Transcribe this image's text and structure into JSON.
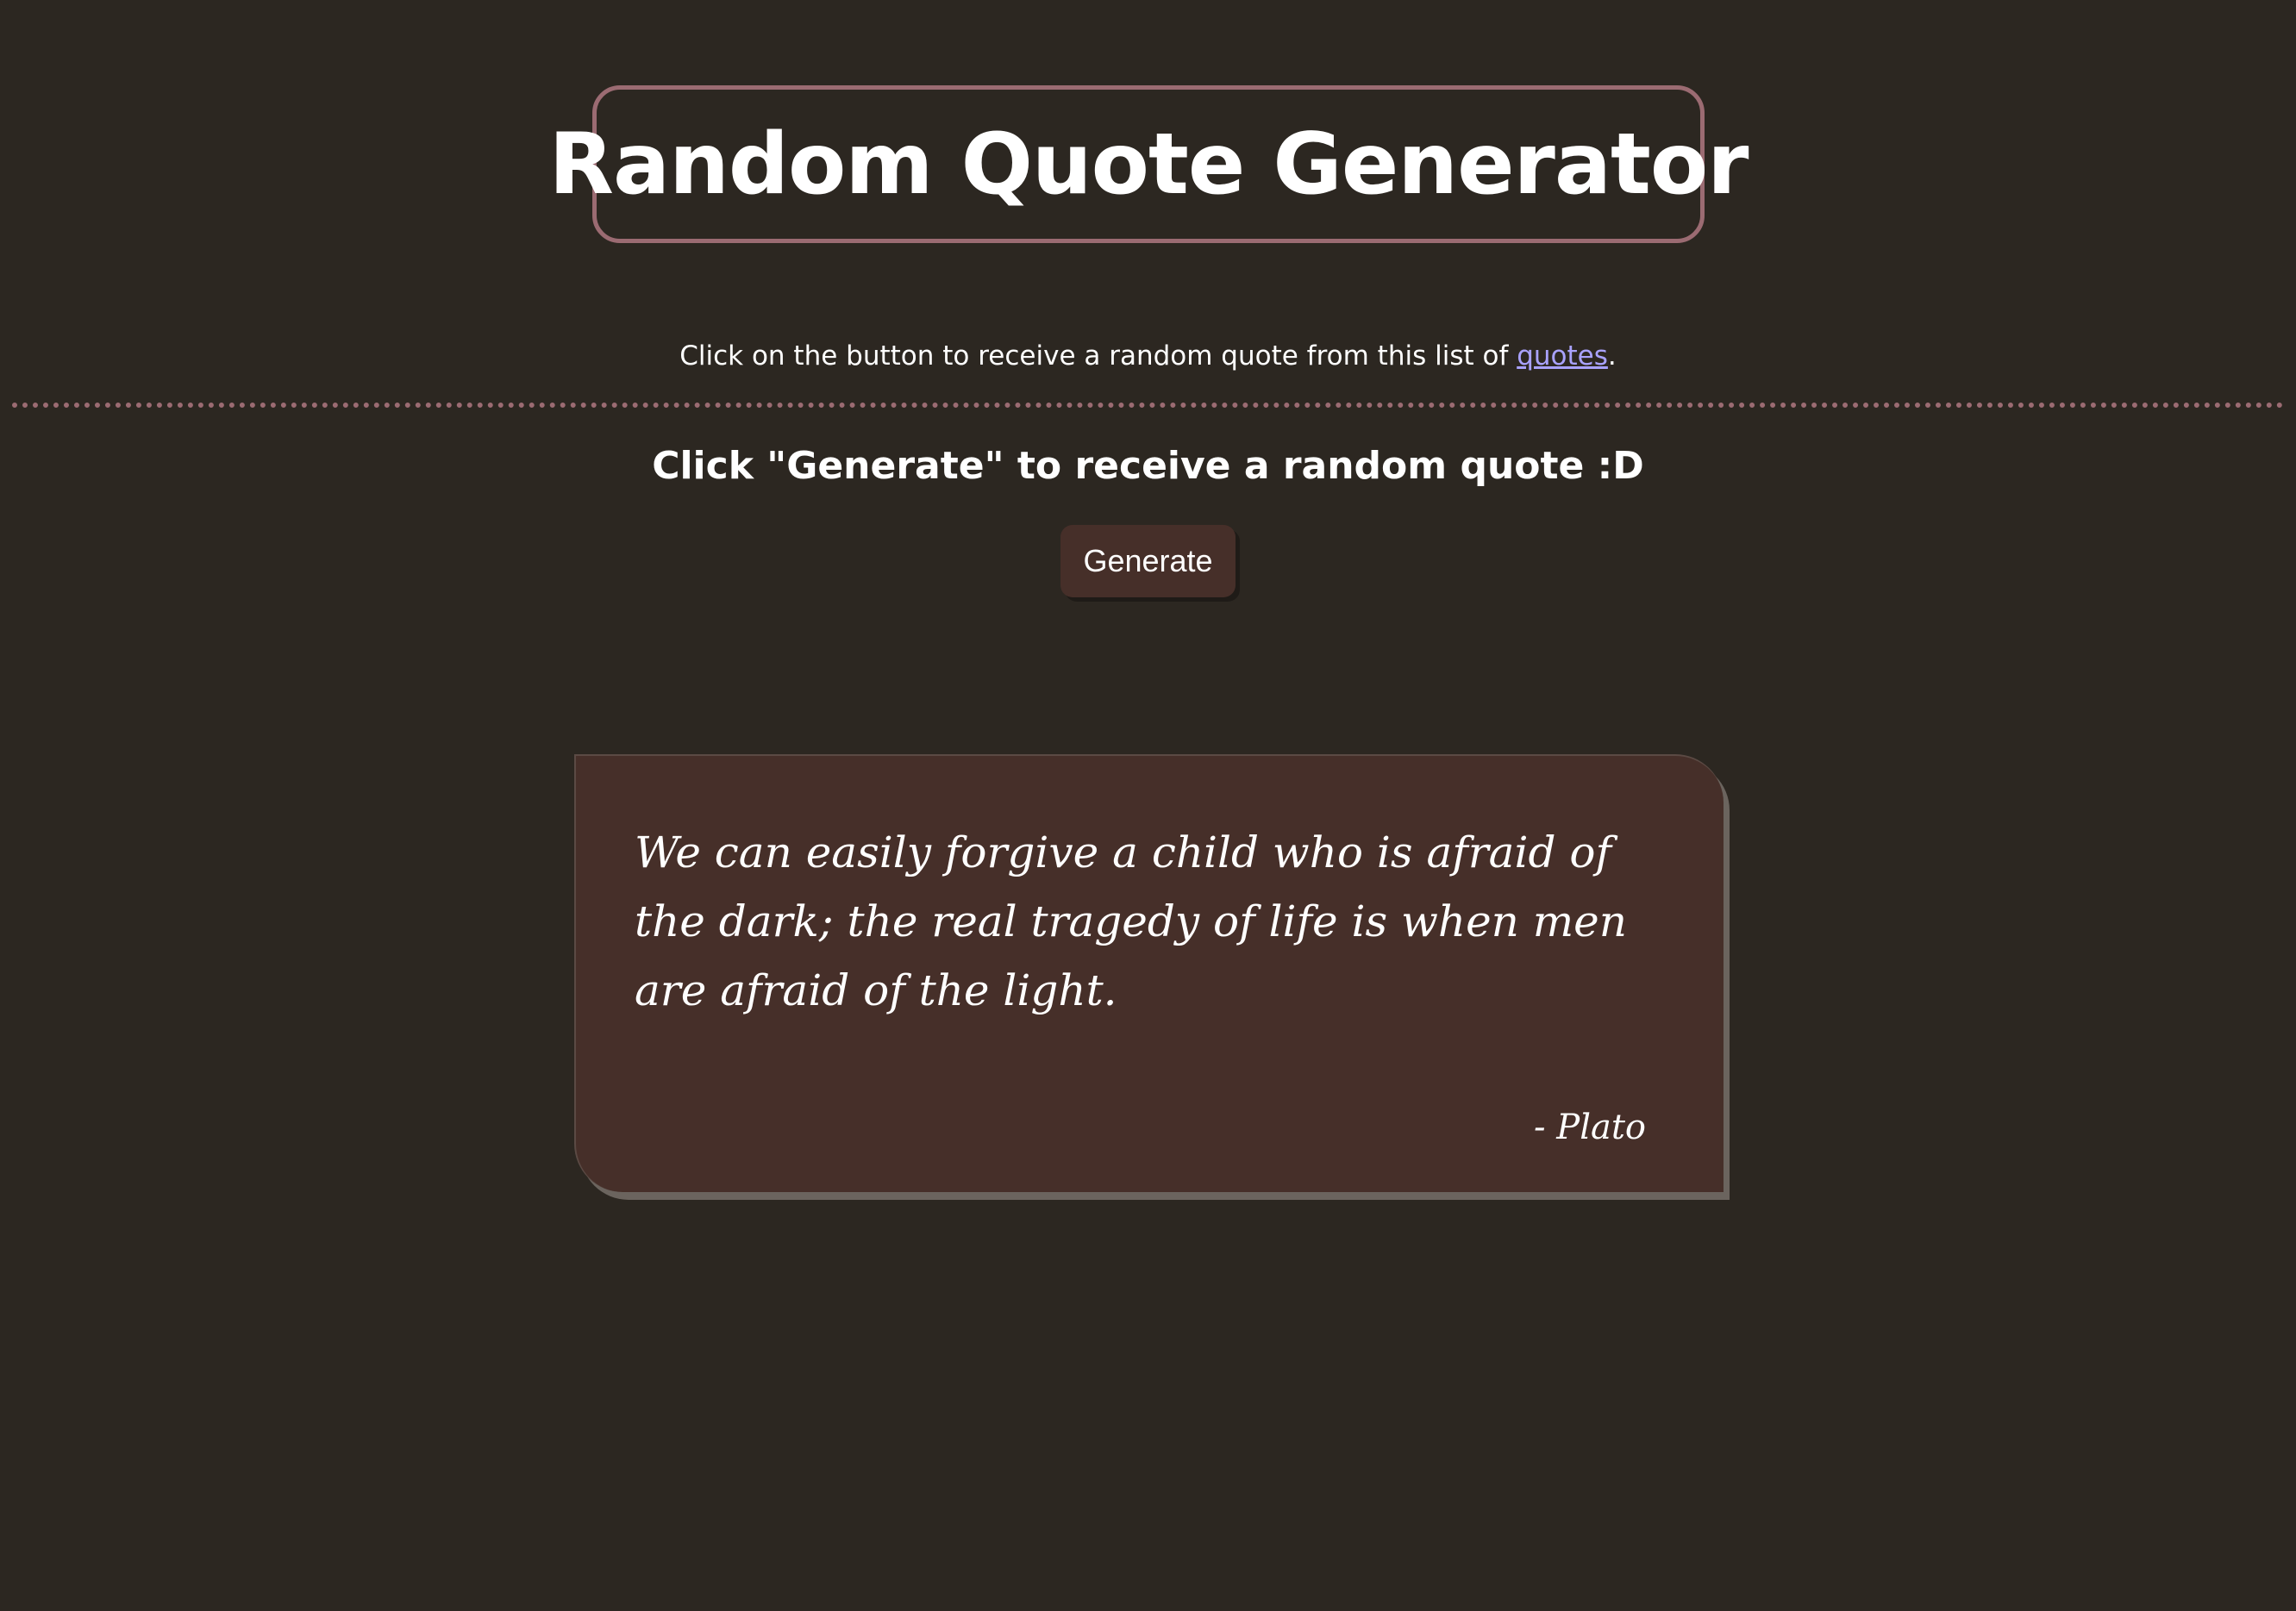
{
  "header": {
    "title": "Random Quote Generator"
  },
  "intro": {
    "text": "Click on the button to receive a random quote from this list of ",
    "link_label": "quotes",
    "suffix": "."
  },
  "generator": {
    "prompt": "Click \"Generate\" to receive a random quote :D",
    "button_label": "Generate"
  },
  "quote": {
    "text": "We can easily forgive a child who is afraid of the dark; the real tragedy of life is when men are afraid of the light.",
    "author": "- Plato"
  },
  "colors": {
    "background": "#2c2721",
    "accent_border": "#9b6b72",
    "card": "#462f29",
    "link": "#a9a2ff"
  }
}
